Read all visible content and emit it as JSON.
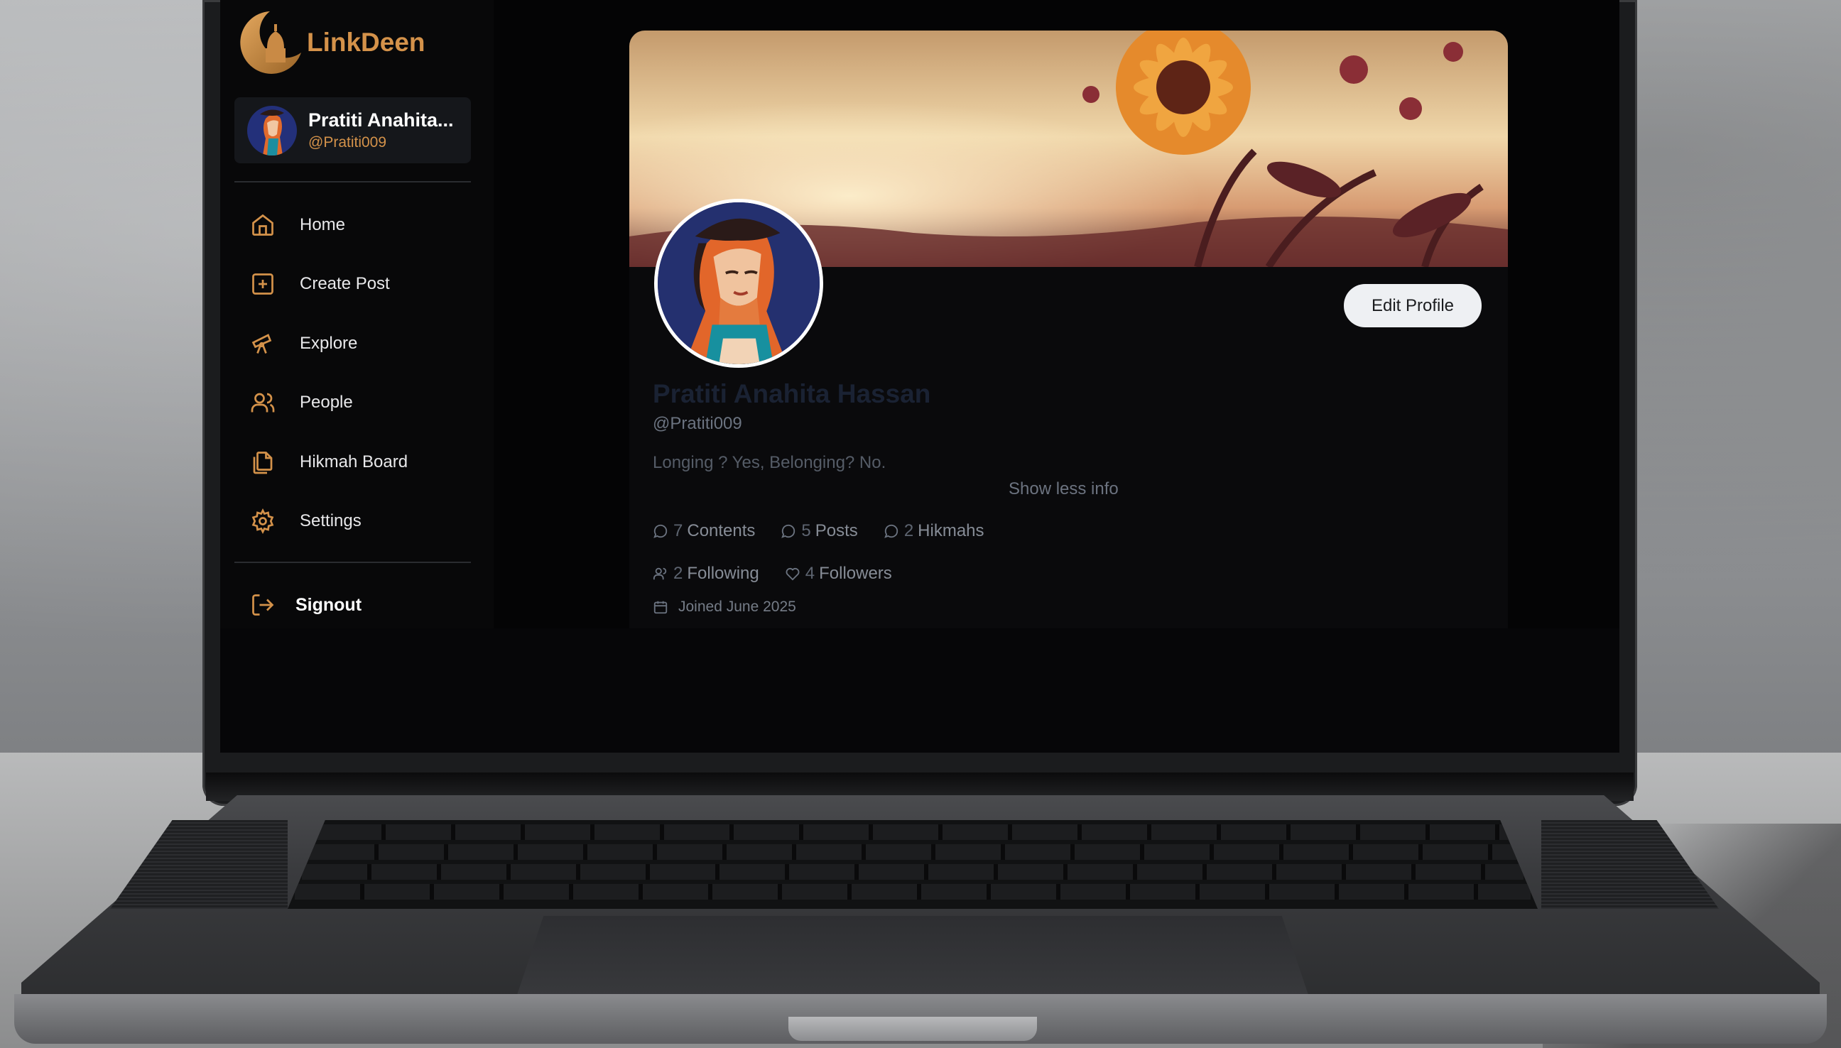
{
  "app": {
    "logo_text": "LinkDeen",
    "brand_color": "#d4924a"
  },
  "user": {
    "name": "Pratiti Anahita...",
    "handle": "@Pratiti009"
  },
  "nav": {
    "items": [
      {
        "label": "Home",
        "icon": "home-icon"
      },
      {
        "label": "Create Post",
        "icon": "plus-square-icon"
      },
      {
        "label": "Explore",
        "icon": "telescope-icon"
      },
      {
        "label": "People",
        "icon": "users-icon"
      },
      {
        "label": "Hikmah Board",
        "icon": "files-icon"
      },
      {
        "label": "Settings",
        "icon": "gear-icon"
      }
    ],
    "signout_label": "Signout"
  },
  "profile": {
    "edit_button": "Edit Profile",
    "full_name": "Pratiti Anahita Hassan",
    "handle": "@Pratiti009",
    "bio": "Longing ? Yes, Belonging? No.",
    "toggle_info": "Show less info",
    "stats_row1": [
      {
        "num": "7",
        "label": "Contents",
        "icon": "message-icon"
      },
      {
        "num": "5",
        "label": "Posts",
        "icon": "message-icon"
      },
      {
        "num": "2",
        "label": "Hikmahs",
        "icon": "message-icon"
      }
    ],
    "stats_row2": [
      {
        "num": "2",
        "label": "Following",
        "icon": "users-icon"
      },
      {
        "num": "4",
        "label": "Followers",
        "icon": "heart-icon"
      }
    ],
    "joined": "Joined June 2025"
  }
}
